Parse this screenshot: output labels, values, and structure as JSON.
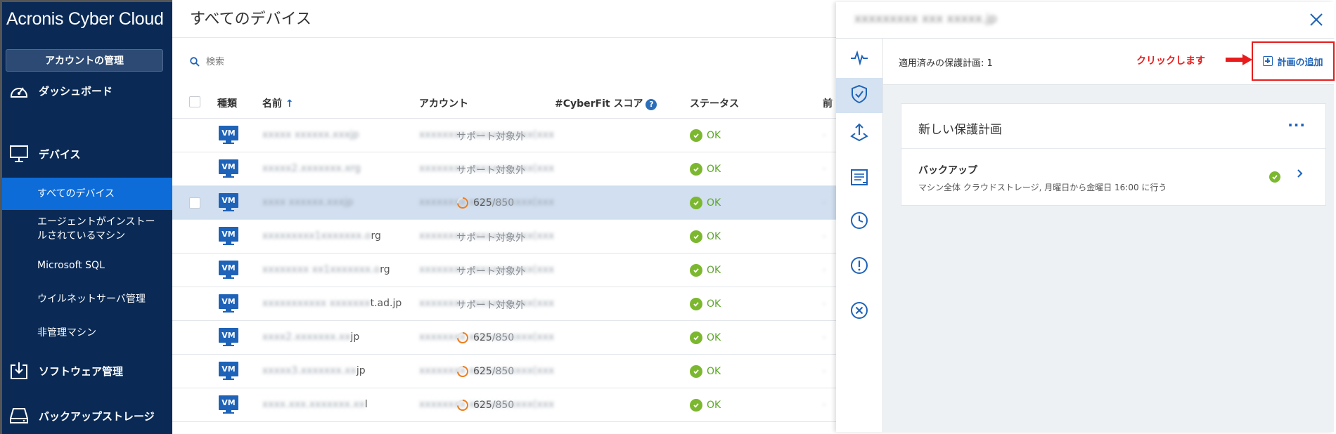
{
  "sidebar": {
    "brand": "Acronis Cyber Cloud",
    "account_button": "アカウントの管理",
    "nav": [
      {
        "label": "ダッシュボード",
        "icon": "dashboard-gauge-icon"
      },
      {
        "label": "デバイス",
        "icon": "monitor-icon"
      },
      {
        "label": "ソフトウェア管理",
        "icon": "download-tray-icon"
      },
      {
        "label": "バックアップストレージ",
        "icon": "storage-drive-icon"
      }
    ],
    "sub_items": [
      {
        "label": "すべてのデバイス",
        "active": true
      },
      {
        "label": "エージェントがインストールされているマシン",
        "active": false
      },
      {
        "label": "Microsoft SQL",
        "active": false
      },
      {
        "label": "ウイルネットサーバ管理",
        "active": false
      },
      {
        "label": "非管理マシン",
        "active": false
      }
    ]
  },
  "main": {
    "title": "すべてのデバイス",
    "search_placeholder": "検索",
    "columns": {
      "type": "種類",
      "name": "名前",
      "name_sort": "↑",
      "account": "アカウント",
      "cyberfit": "#CyberFit スコア",
      "cyberfit_help": "?",
      "status": "ステータス",
      "extra": "前"
    },
    "rows": [
      {
        "type": "VM",
        "name": "xxxxx xxxxxx.xxxjp",
        "name_tail": "",
        "account": "xxxxxxxx xxxxxxxxxxx(xxx",
        "score": "サポート対象外",
        "score_max": "",
        "score_fraction": 0,
        "status": "OK",
        "extra": "-",
        "selected": false
      },
      {
        "type": "VM",
        "name": "xxxxx2.xxxxxxx.xrg",
        "name_tail": "",
        "account": "xxxxxxxx xxxxxxxxxxx(xxx",
        "score": "サポート対象外",
        "score_max": "",
        "score_fraction": 0,
        "status": "OK",
        "extra": "-",
        "selected": false
      },
      {
        "type": "VM",
        "name": "xxxx xxxxxx.xxxjp",
        "name_tail": "",
        "account": "xxxxxxxx xxxxxxxxxxx(xxx",
        "score": "625",
        "score_max": "/850",
        "score_fraction": 0.735,
        "status": "OK",
        "extra": "-",
        "selected": true
      },
      {
        "type": "VM",
        "name": "xxxxxxxxx1xxxxxxx.o",
        "name_tail": "rg",
        "account": "xxxxxxxx xxxxxxxxxxx(xxx",
        "score": "サポート対象外",
        "score_max": "",
        "score_fraction": 0,
        "status": "OK",
        "extra": "-",
        "selected": false
      },
      {
        "type": "VM",
        "name": "xxxxxxxx xx1xxxxxxx.o",
        "name_tail": "rg",
        "account": "xxxxxxxx xxxxxxxxxxx(xxx",
        "score": "サポート対象外",
        "score_max": "",
        "score_fraction": 0,
        "status": "OK",
        "extra": "-",
        "selected": false
      },
      {
        "type": "VM",
        "name": "xxxxxxxxxxx xxxxxxx",
        "name_tail": "t.ad.jp",
        "account": "xxxxxxxx xxxxxxxxxxx(xxx",
        "score": "サポート対象外",
        "score_max": "",
        "score_fraction": 0,
        "status": "OK",
        "extra": "-",
        "selected": false
      },
      {
        "type": "VM",
        "name": "xxxx2.xxxxxxx.xx",
        "name_tail": "jp",
        "account": "xxxxxxxx xxxxxxxxxxx(xxx",
        "score": "625",
        "score_max": "/850",
        "score_fraction": 0.735,
        "status": "OK",
        "extra": "-",
        "selected": false
      },
      {
        "type": "VM",
        "name": "xxxxx3.xxxxxxx.xx",
        "name_tail": "jp",
        "account": "xxxxxxxx xxxxxxxxxxx(xxx",
        "score": "625",
        "score_max": "/850",
        "score_fraction": 0.735,
        "status": "OK",
        "extra": "-",
        "selected": false
      },
      {
        "type": "VM",
        "name": "xxxx.xxx.xxxxxxx.xx",
        "name_tail": "l",
        "account": "xxxxxxxx xxxxxxxxxxx(xxx",
        "score": "625",
        "score_max": "/850",
        "score_fraction": 0.735,
        "status": "OK",
        "extra": "-",
        "selected": false
      }
    ]
  },
  "panel": {
    "device_name": "xxxxxxxxx xxx xxxxx.jp",
    "applied_label": "適用済みの保護計画: 1",
    "annotation": "クリックします",
    "add_plan_label": "計画の追加",
    "rail_icons": [
      "activity-pulse-icon",
      "shield-check-icon",
      "recovery-upload-icon",
      "report-list-icon",
      "history-clock-icon",
      "alert-exclamation-icon",
      "cancel-circle-icon"
    ],
    "plan": {
      "title": "新しい保護計画",
      "more": "···",
      "backup_title": "バックアップ",
      "backup_desc": "マシン全体 クラウドストレージ, 月曜日から金曜日 16:00 に行う"
    }
  },
  "colors": {
    "sidebar_bg": "#0a2a55",
    "active_item": "#0d6cd8",
    "accent_blue": "#1e63b8",
    "ok_green": "#7cb82f",
    "score_orange": "#f07d1a",
    "annotation_red": "#e81c1c"
  }
}
